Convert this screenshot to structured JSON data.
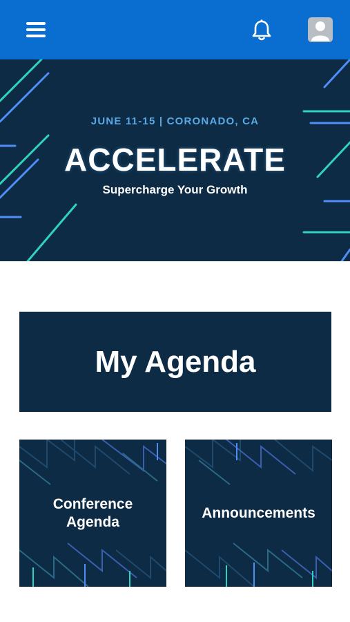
{
  "header": {
    "menu_icon": "hamburger-menu-icon",
    "notifications_icon": "bell-icon",
    "profile_icon": "user-avatar-icon",
    "background_color": "#0a6ed1"
  },
  "banner": {
    "date_location": "JUNE 11-15 | CORONADO, CA",
    "title": "ACCELERATE",
    "subtitle": "Supercharge Your Growth",
    "background_color": "#0d2b44",
    "accent_colors": [
      "#2fd3c0",
      "#4f8ef7",
      "#58a9e6"
    ]
  },
  "tiles": {
    "my_agenda": {
      "label": "My Agenda"
    },
    "conference_agenda": {
      "line1": "Conference",
      "line2": "Agenda"
    },
    "announcements": {
      "label": "Announcements"
    }
  }
}
